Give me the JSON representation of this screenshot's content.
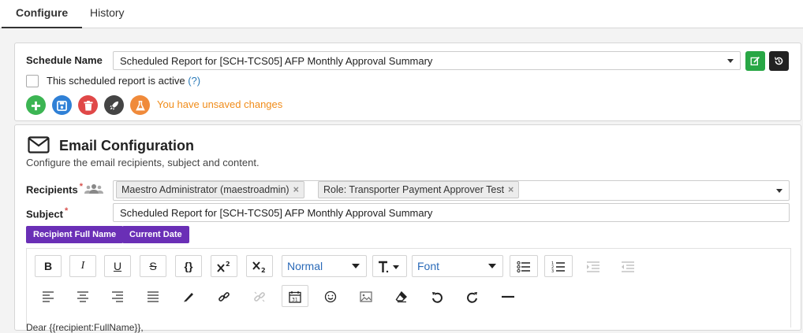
{
  "tabs": [
    {
      "label": "Configure",
      "active": true
    },
    {
      "label": "History",
      "active": false
    }
  ],
  "schedule": {
    "name_label": "Schedule Name",
    "name_value": "Scheduled Report for [SCH-TCS05] AFP Monthly Approval Summary",
    "active_label": "This scheduled report is active",
    "help_label": "(?)",
    "active_checked": false,
    "unsaved_text": "You have unsaved changes",
    "actions": [
      {
        "icon": "plus-icon",
        "color": "#3cb553"
      },
      {
        "icon": "save-icon",
        "color": "#2f80d6"
      },
      {
        "icon": "trash-icon",
        "color": "#e04848"
      },
      {
        "icon": "rocket-icon",
        "color": "#444444"
      },
      {
        "icon": "flask-icon",
        "color": "#f08a3a"
      }
    ],
    "edit_button_color": "#28a745",
    "history_button_color": "#222222"
  },
  "email": {
    "title": "Email Configuration",
    "description": "Configure the email recipients, subject and content.",
    "recipients_label": "Recipients",
    "recipients": [
      "Maestro Administrator (maestroadmin)",
      "Role: Transporter Payment Approver Test"
    ],
    "subject_label": "Subject",
    "subject_value": "Scheduled Report for [SCH-TCS05] AFP Monthly Approval Summary",
    "placeholders": [
      "Recipient Full Name",
      "Current Date"
    ],
    "toolbar": {
      "format_select": "Normal",
      "font_select": "Font",
      "bold": "B",
      "italic": "I",
      "underline": "U",
      "strike": "S",
      "code": "{}"
    },
    "body_preview": "Dear {{recipient:FullName}},"
  }
}
